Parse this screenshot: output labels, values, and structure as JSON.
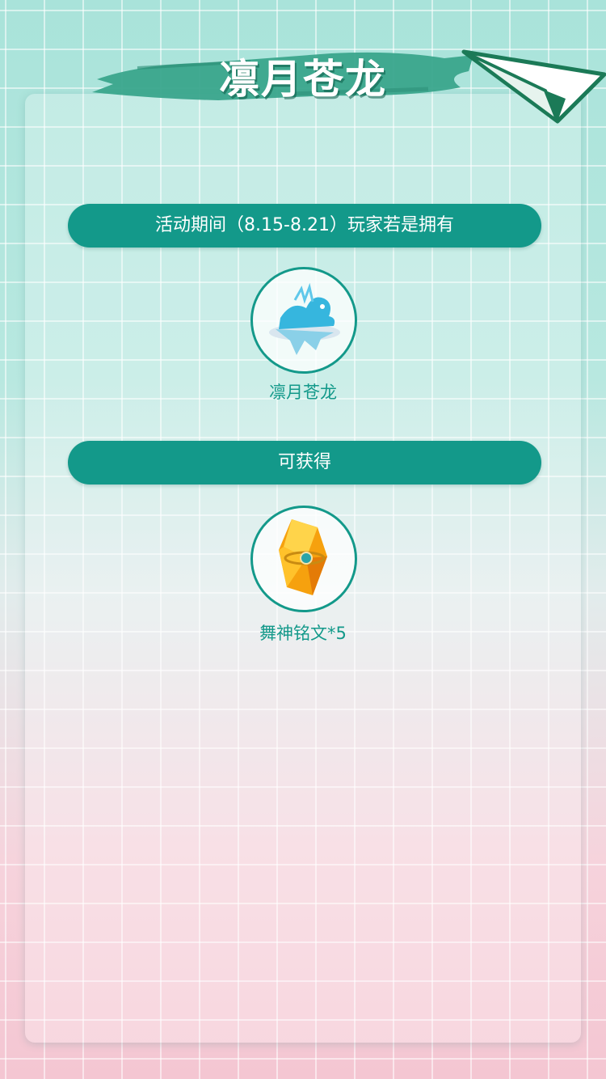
{
  "page": {
    "title": "凛月苍龙",
    "condition_banner": "活动期间（8.15-8.21）玩家若是拥有",
    "owned_item": {
      "name": "凛月苍龙",
      "icon": "ice-dragon-icon"
    },
    "reward_banner": "可获得",
    "reward_item": {
      "name": "舞神铭文*5",
      "icon": "amber-crystal-icon"
    }
  },
  "colors": {
    "accent": "#13998a",
    "title_brush": "#3aa58c",
    "bg_top": "#a9e3da",
    "bg_bottom": "#f4c6d2"
  }
}
